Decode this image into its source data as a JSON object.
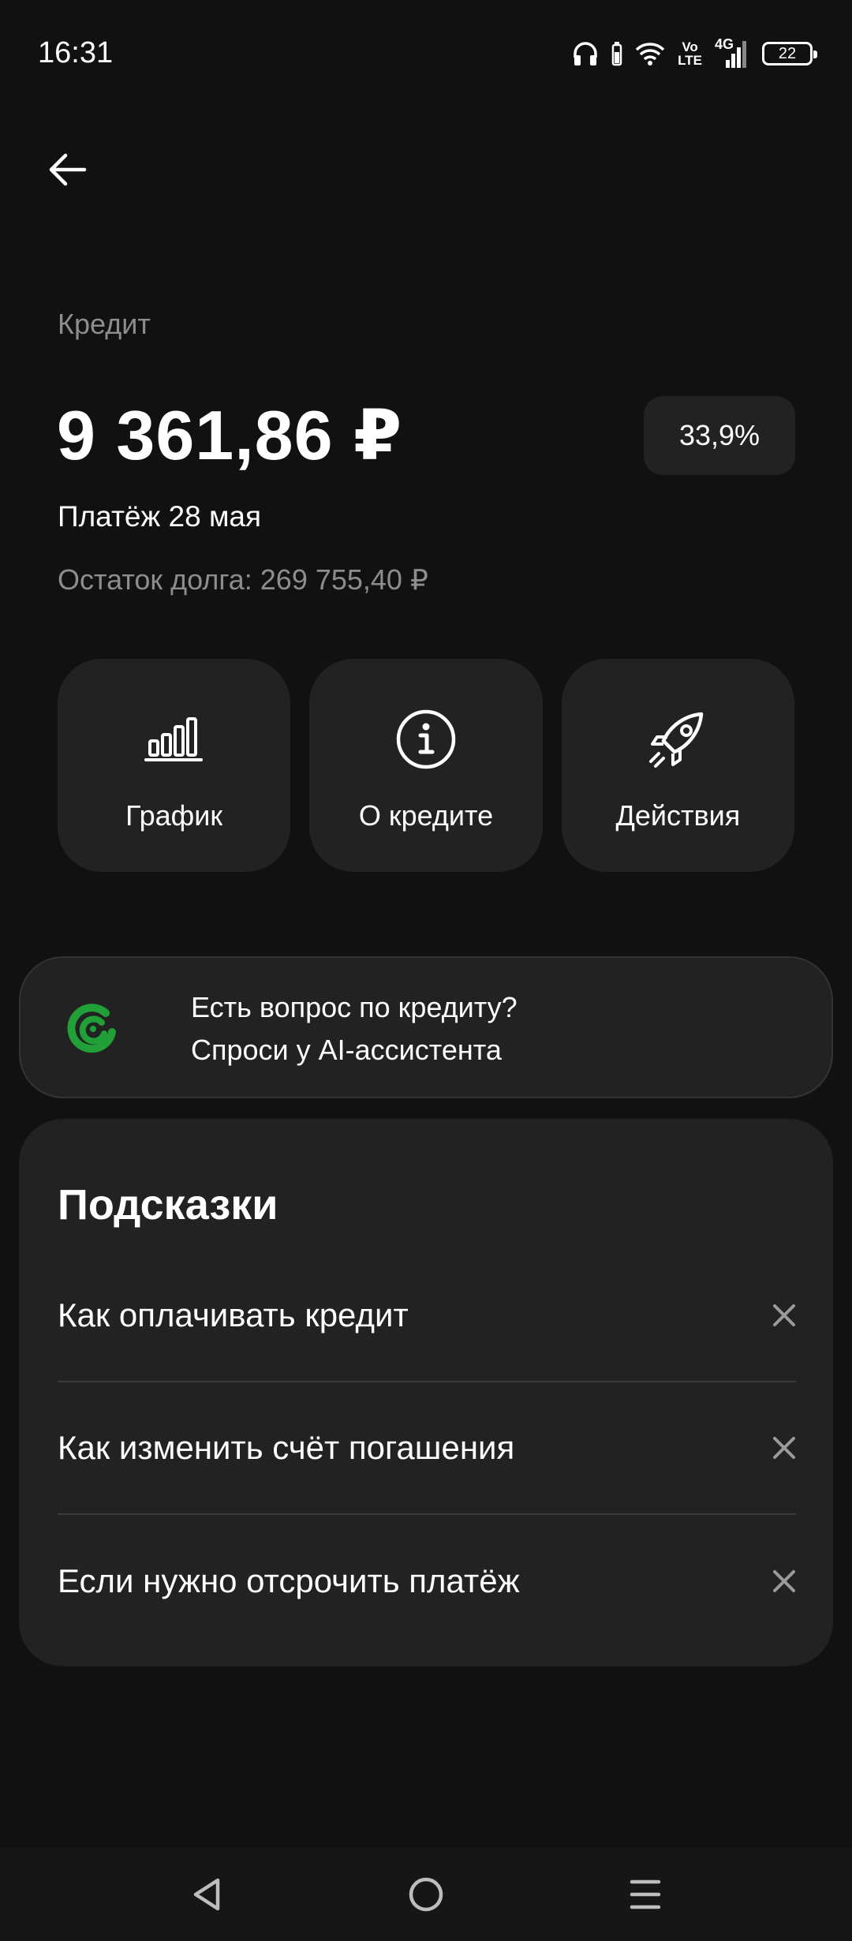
{
  "status_bar": {
    "time": "16:31",
    "icons": [
      "headphones-icon",
      "battery-saver-icon",
      "wifi-icon",
      "volte-icon",
      "signal-4g-icon",
      "battery-icon"
    ],
    "volte_top": "Vo",
    "volte_bottom": "LTE",
    "network": "4G",
    "battery_level": "22"
  },
  "header": {
    "back_icon": "arrow-left-icon",
    "product_label": "Кредит",
    "amount": "9 361,86 ₽",
    "rate": "33,9%",
    "payment_date": "Платёж 28 мая",
    "debt_remaining": "Остаток долга: 269 755,40 ₽"
  },
  "actions": [
    {
      "icon": "bar-chart-icon",
      "label": "График"
    },
    {
      "icon": "info-icon",
      "label": "О кредите"
    },
    {
      "icon": "rocket-icon",
      "label": "Действия"
    }
  ],
  "ai_banner": {
    "icon": "sber-ai-logo",
    "line1": "Есть вопрос по кредиту?",
    "line2": "Спроси у AI-ассистента"
  },
  "tips": {
    "title": "Подсказки",
    "items": [
      {
        "label": "Как оплачивать кредит"
      },
      {
        "label": "Как изменить счёт погашения"
      },
      {
        "label": "Если нужно отсрочить платёж"
      }
    ],
    "close_icon": "close-icon"
  },
  "nav_bar": {
    "icons": [
      "back-triangle-icon",
      "home-circle-icon",
      "menu-lines-icon"
    ]
  },
  "colors": {
    "background": "#111111",
    "card": "#222222",
    "muted_text": "#8d8d8d",
    "accent_green": "#21a038"
  }
}
